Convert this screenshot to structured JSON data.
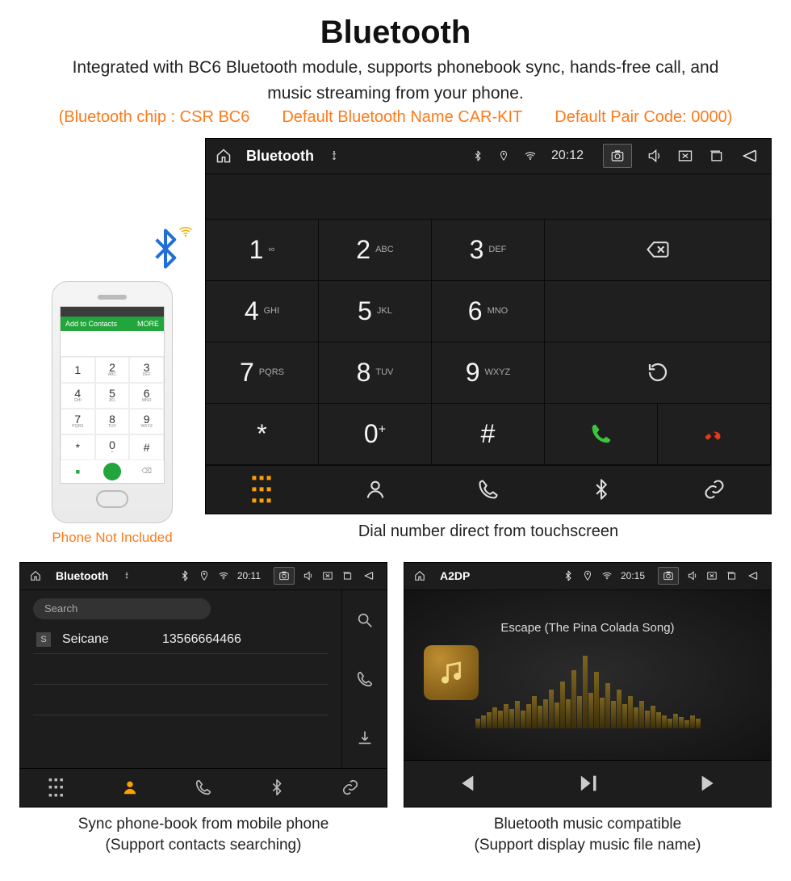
{
  "title": "Bluetooth",
  "subtitle_line1": "Integrated with BC6 Bluetooth module, supports phonebook sync, hands-free call, and",
  "subtitle_line2": "music streaming from your phone.",
  "orange": {
    "chip": "(Bluetooth chip : CSR BC6",
    "name": "Default Bluetooth Name CAR-KIT",
    "code": "Default Pair Code: 0000)"
  },
  "phone_caption": "Phone Not Included",
  "phone_ui": {
    "add_contacts": "Add to Contacts",
    "more": "MORE",
    "keys": [
      {
        "n": "1",
        "s": ""
      },
      {
        "n": "2",
        "s": "ABC"
      },
      {
        "n": "3",
        "s": "DEF"
      },
      {
        "n": "4",
        "s": "GHI"
      },
      {
        "n": "5",
        "s": "JKL"
      },
      {
        "n": "6",
        "s": "MNO"
      },
      {
        "n": "7",
        "s": "PQRS"
      },
      {
        "n": "8",
        "s": "TUV"
      },
      {
        "n": "9",
        "s": "WXYZ"
      },
      {
        "n": "*",
        "s": ""
      },
      {
        "n": "0",
        "s": "+"
      },
      {
        "n": "#",
        "s": ""
      }
    ]
  },
  "headunit1": {
    "title": "Bluetooth",
    "time": "20:12",
    "dial": [
      {
        "num": "1",
        "sub": "∞"
      },
      {
        "num": "2",
        "sub": "ABC"
      },
      {
        "num": "3",
        "sub": "DEF"
      },
      {
        "num": "4",
        "sub": "GHI"
      },
      {
        "num": "5",
        "sub": "JKL"
      },
      {
        "num": "6",
        "sub": "MNO"
      },
      {
        "num": "7",
        "sub": "PQRS"
      },
      {
        "num": "8",
        "sub": "TUV"
      },
      {
        "num": "9",
        "sub": "WXYZ"
      },
      {
        "num": "*",
        "sub": ""
      },
      {
        "num": "0",
        "sub": "+"
      },
      {
        "num": "#",
        "sub": ""
      }
    ],
    "caption": "Dial number direct from touchscreen"
  },
  "panel_contacts": {
    "title": "Bluetooth",
    "time": "20:11",
    "search_placeholder": "Search",
    "row": {
      "initial": "S",
      "name": "Seicane",
      "number": "13566664466"
    },
    "caption_l1": "Sync phone-book from mobile phone",
    "caption_l2": "(Support contacts searching)"
  },
  "panel_a2dp": {
    "title": "A2DP",
    "time": "20:15",
    "song": "Escape (The Pina Colada Song)",
    "caption_l1": "Bluetooth music compatible",
    "caption_l2": "(Support display music file name)"
  },
  "viz_heights": [
    12,
    16,
    20,
    26,
    22,
    30,
    24,
    34,
    22,
    30,
    40,
    28,
    36,
    48,
    32,
    58,
    36,
    72,
    40,
    90,
    44,
    70,
    38,
    56,
    34,
    48,
    30,
    40,
    26,
    34,
    22,
    28,
    20,
    16,
    12,
    18,
    14,
    10,
    16,
    12
  ]
}
